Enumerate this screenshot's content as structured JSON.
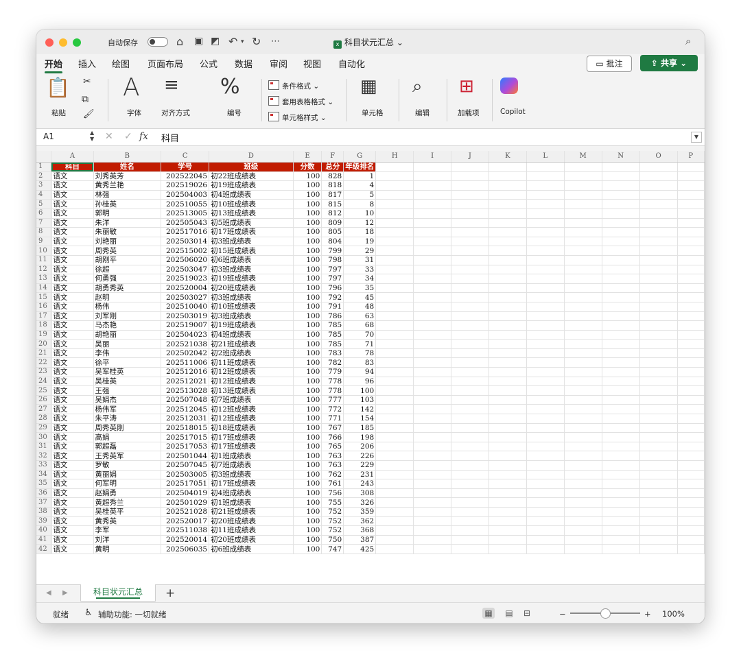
{
  "titlebar": {
    "autosave": "自动保存",
    "doc_title": "科目状元汇总"
  },
  "menu": [
    "开始",
    "插入",
    "绘图",
    "页面布局",
    "公式",
    "数据",
    "审阅",
    "视图",
    "自动化"
  ],
  "comment_label": "批注",
  "share_label": "共享",
  "ribbon": {
    "paste": "粘贴",
    "font": "字体",
    "align": "对齐方式",
    "number": "编号",
    "cond": "条件格式",
    "table_fmt": "套用表格格式",
    "cell_style": "单元格样式",
    "cells": "单元格",
    "edit": "编辑",
    "addins": "加载项",
    "copilot": "Copilot",
    "font_glyph": "A",
    "number_glyph": "%"
  },
  "formula": {
    "namebox": "A1",
    "fx": "fx",
    "value": "科目"
  },
  "columns": [
    "A",
    "B",
    "C",
    "D",
    "E",
    "F",
    "G",
    "H",
    "I",
    "J",
    "K",
    "L",
    "M",
    "N",
    "O",
    "P"
  ],
  "headers": [
    "科目",
    "姓名",
    "学号",
    "班级",
    "分数",
    "总分",
    "年级排名"
  ],
  "rows": [
    [
      "语文",
      "刘秀英芳",
      "202522045",
      "初22班成绩表",
      "100",
      "828",
      "1"
    ],
    [
      "语文",
      "黄秀兰艳",
      "202519026",
      "初19班成绩表",
      "100",
      "818",
      "4"
    ],
    [
      "语文",
      "林强",
      "202504003",
      "初4班成绩表",
      "100",
      "817",
      "5"
    ],
    [
      "语文",
      "孙桂英",
      "202510055",
      "初10班成绩表",
      "100",
      "815",
      "8"
    ],
    [
      "语文",
      "郭明",
      "202513005",
      "初13班成绩表",
      "100",
      "812",
      "10"
    ],
    [
      "语文",
      "朱洋",
      "202505043",
      "初5班成绩表",
      "100",
      "809",
      "12"
    ],
    [
      "语文",
      "朱丽敏",
      "202517016",
      "初17班成绩表",
      "100",
      "805",
      "18"
    ],
    [
      "语文",
      "刘艳丽",
      "202503014",
      "初3班成绩表",
      "100",
      "804",
      "19"
    ],
    [
      "语文",
      "周秀英",
      "202515002",
      "初15班成绩表",
      "100",
      "799",
      "29"
    ],
    [
      "语文",
      "胡刚平",
      "202506020",
      "初6班成绩表",
      "100",
      "798",
      "31"
    ],
    [
      "语文",
      "徐超",
      "202503047",
      "初3班成绩表",
      "100",
      "797",
      "33"
    ],
    [
      "语文",
      "何勇强",
      "202519023",
      "初19班成绩表",
      "100",
      "797",
      "34"
    ],
    [
      "语文",
      "胡勇秀英",
      "202520004",
      "初20班成绩表",
      "100",
      "796",
      "35"
    ],
    [
      "语文",
      "赵明",
      "202503027",
      "初3班成绩表",
      "100",
      "792",
      "45"
    ],
    [
      "语文",
      "杨伟",
      "202510040",
      "初10班成绩表",
      "100",
      "791",
      "48"
    ],
    [
      "语文",
      "刘军刚",
      "202503019",
      "初3班成绩表",
      "100",
      "786",
      "63"
    ],
    [
      "语文",
      "马杰艳",
      "202519007",
      "初19班成绩表",
      "100",
      "785",
      "68"
    ],
    [
      "语文",
      "胡艳丽",
      "202504023",
      "初4班成绩表",
      "100",
      "785",
      "70"
    ],
    [
      "语文",
      "吴丽",
      "202521038",
      "初21班成绩表",
      "100",
      "785",
      "71"
    ],
    [
      "语文",
      "李伟",
      "202502042",
      "初2班成绩表",
      "100",
      "783",
      "78"
    ],
    [
      "语文",
      "徐平",
      "202511006",
      "初11班成绩表",
      "100",
      "782",
      "83"
    ],
    [
      "语文",
      "吴军桂英",
      "202512016",
      "初12班成绩表",
      "100",
      "779",
      "94"
    ],
    [
      "语文",
      "吴桂英",
      "202512021",
      "初12班成绩表",
      "100",
      "778",
      "96"
    ],
    [
      "语文",
      "王强",
      "202513028",
      "初13班成绩表",
      "100",
      "778",
      "100"
    ],
    [
      "语文",
      "吴娟杰",
      "202507048",
      "初7班成绩表",
      "100",
      "777",
      "103"
    ],
    [
      "语文",
      "杨伟军",
      "202512045",
      "初12班成绩表",
      "100",
      "772",
      "142"
    ],
    [
      "语文",
      "朱平涛",
      "202512031",
      "初12班成绩表",
      "100",
      "771",
      "154"
    ],
    [
      "语文",
      "周秀英刚",
      "202518015",
      "初18班成绩表",
      "100",
      "767",
      "185"
    ],
    [
      "语文",
      "高娟",
      "202517015",
      "初17班成绩表",
      "100",
      "766",
      "198"
    ],
    [
      "语文",
      "郭超磊",
      "202517053",
      "初17班成绩表",
      "100",
      "765",
      "206"
    ],
    [
      "语文",
      "王秀英军",
      "202501044",
      "初1班成绩表",
      "100",
      "763",
      "226"
    ],
    [
      "语文",
      "罗敏",
      "202507045",
      "初7班成绩表",
      "100",
      "763",
      "229"
    ],
    [
      "语文",
      "黄丽娟",
      "202503005",
      "初3班成绩表",
      "100",
      "762",
      "231"
    ],
    [
      "语文",
      "何军明",
      "202517051",
      "初17班成绩表",
      "100",
      "761",
      "243"
    ],
    [
      "语文",
      "赵娟勇",
      "202504019",
      "初4班成绩表",
      "100",
      "756",
      "308"
    ],
    [
      "语文",
      "黄超秀兰",
      "202501029",
      "初1班成绩表",
      "100",
      "755",
      "326"
    ],
    [
      "语文",
      "吴桂英平",
      "202521028",
      "初21班成绩表",
      "100",
      "752",
      "359"
    ],
    [
      "语文",
      "黄秀英",
      "202520017",
      "初20班成绩表",
      "100",
      "752",
      "362"
    ],
    [
      "语文",
      "李军",
      "202511038",
      "初11班成绩表",
      "100",
      "752",
      "368"
    ],
    [
      "语文",
      "刘洋",
      "202520014",
      "初20班成绩表",
      "100",
      "750",
      "387"
    ],
    [
      "语文",
      "黄明",
      "202506035",
      "初6班成绩表",
      "100",
      "747",
      "425"
    ]
  ],
  "sheet_tab": "科目状元汇总",
  "status": {
    "ready": "就绪",
    "accessibility": "辅助功能: 一切就绪",
    "zoom": "100%"
  }
}
